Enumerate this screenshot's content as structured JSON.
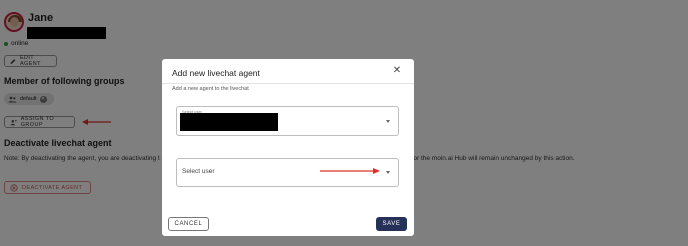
{
  "agent": {
    "name": "Jane",
    "status": "online",
    "edit_label": "EDIT AGENT"
  },
  "groups": {
    "heading": "Member of following groups",
    "chips": [
      "default"
    ],
    "assign_label": "ASSIGN TO GROUP"
  },
  "deactivate": {
    "heading": "Deactivate livechat agent",
    "note": "Note: By deactivating the agent, you are deactivating t                                                                                                                                                              s it was a member in. Apart of not being a livechat agents any longer, the user account for the moin.ai Hub will remain unchanged by this action.",
    "button_label": "DEACTIVATE AGENT"
  },
  "modal": {
    "title": "Add new livechat agent",
    "description": "Add a new agent to the livechat",
    "field1_label": "Select user",
    "field2_placeholder": "Select user",
    "cancel_label": "CANCEL",
    "save_label": "SAVE",
    "close_glyph": "✕"
  },
  "colors": {
    "annotation_arrow": "#e0302a",
    "save_bg": "#26315a",
    "online": "#3b9a4a"
  },
  "icons": {
    "edit": "pencil-icon",
    "assign": "person-add-icon",
    "chip": "group-icon",
    "deactivate": "cancel-circle-icon"
  }
}
